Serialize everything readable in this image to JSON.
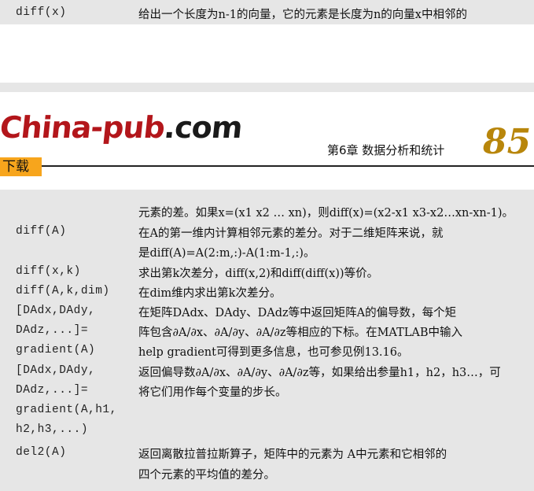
{
  "top_row": {
    "code": "diff(x)",
    "description": "给出一个长度为n-1的向量，它的元素是长度为n的向量x中相邻的"
  },
  "header": {
    "logo_text": "China-pub",
    "logo_suffix": ".com",
    "download_label": "下载",
    "chapter_title": "第6章  数据分析和统计",
    "page_number": "85"
  },
  "code_lines": [
    "diff(A)",
    "diff(x,k)",
    "diff(A,k,dim)",
    "[DAdx,DAdy,",
    "DAdz,...]=",
    "gradient(A)",
    "[DAdx,DAdy,",
    "DAdz,...]=",
    "gradient(A,h1,",
    "h2,h3,...)",
    "del2(A)"
  ],
  "desc_lines": [
    "元素的差。如果x=(x1 x2 … xn)，则diff(x)=(x2-x1 x3-x2…xn-xn-1)。",
    "在A的第一维内计算相邻元素的差分。对于二维矩阵来说，就",
    "是diff(A)=A(2:m,:)-A(1:m-1,:)。",
    "求出第k次差分，diff(x,2)和diff(diff(x))等价。",
    "在dim维内求出第k次差分。",
    "在矩阵DAdx、DAdy、DAdz等中返回矩阵A的偏导数，每个矩",
    "阵包含∂A/∂x、∂A/∂y、∂A/∂z等相应的下标。在MATLAB中输入",
    "help gradient可得到更多信息，也可参见例13.16。",
    "返回偏导数∂A/∂x、∂A/∂y、∂A/∂z等，如果给出参量h1，h2，h3…，可",
    "将它们用作每个变量的步长。",
    "返回离散拉普拉斯算子，矩阵中的元素为 A中元素和它相邻的",
    "四个元素的平均值的差分。"
  ]
}
